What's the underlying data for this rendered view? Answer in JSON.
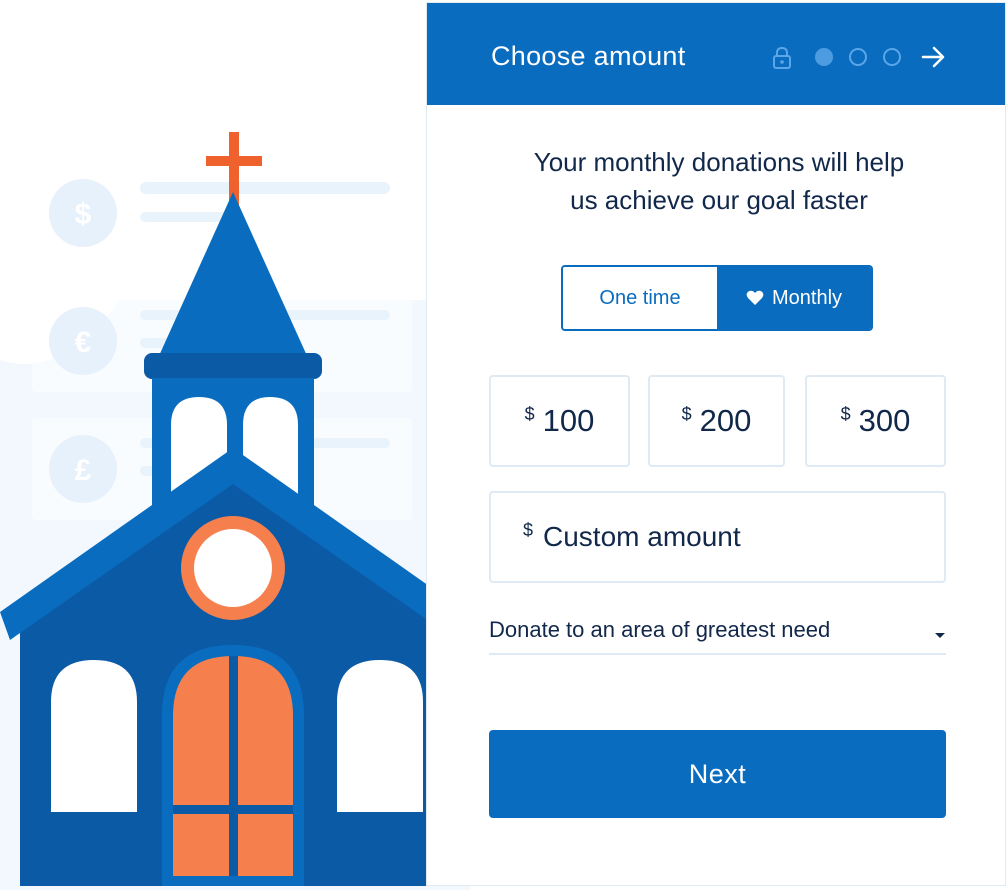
{
  "header": {
    "title": "Choose amount",
    "lock_icon": "lock-icon",
    "progress_steps_total": 3,
    "progress_step_active": 1,
    "next_icon": "arrow-right-icon"
  },
  "message": {
    "line1": "Your monthly donations will help",
    "line2": "us achieve our goal faster"
  },
  "frequency": {
    "options": [
      {
        "label": "One time",
        "selected": false
      },
      {
        "label": "Monthly",
        "selected": true,
        "icon": "heart-icon"
      }
    ]
  },
  "amounts": [
    {
      "currency": "$",
      "value": "100"
    },
    {
      "currency": "$",
      "value": "200"
    },
    {
      "currency": "$",
      "value": "300"
    }
  ],
  "custom_amount": {
    "currency": "$",
    "placeholder": "Custom amount"
  },
  "designation": {
    "selected": "Donate to an area of greatest need",
    "icon": "caret-down-icon"
  },
  "next_button": {
    "label": "Next"
  },
  "illustration": {
    "subject": "church",
    "currency_symbols": [
      "$",
      "€",
      "£"
    ]
  },
  "colors": {
    "primary": "#0a6cbf",
    "primary_dark": "#0b5aa5",
    "accent": "#f5804e",
    "cross": "#f0622d",
    "border": "#dfeaf4",
    "text": "#12284a",
    "pale": "#e9f3fc"
  }
}
